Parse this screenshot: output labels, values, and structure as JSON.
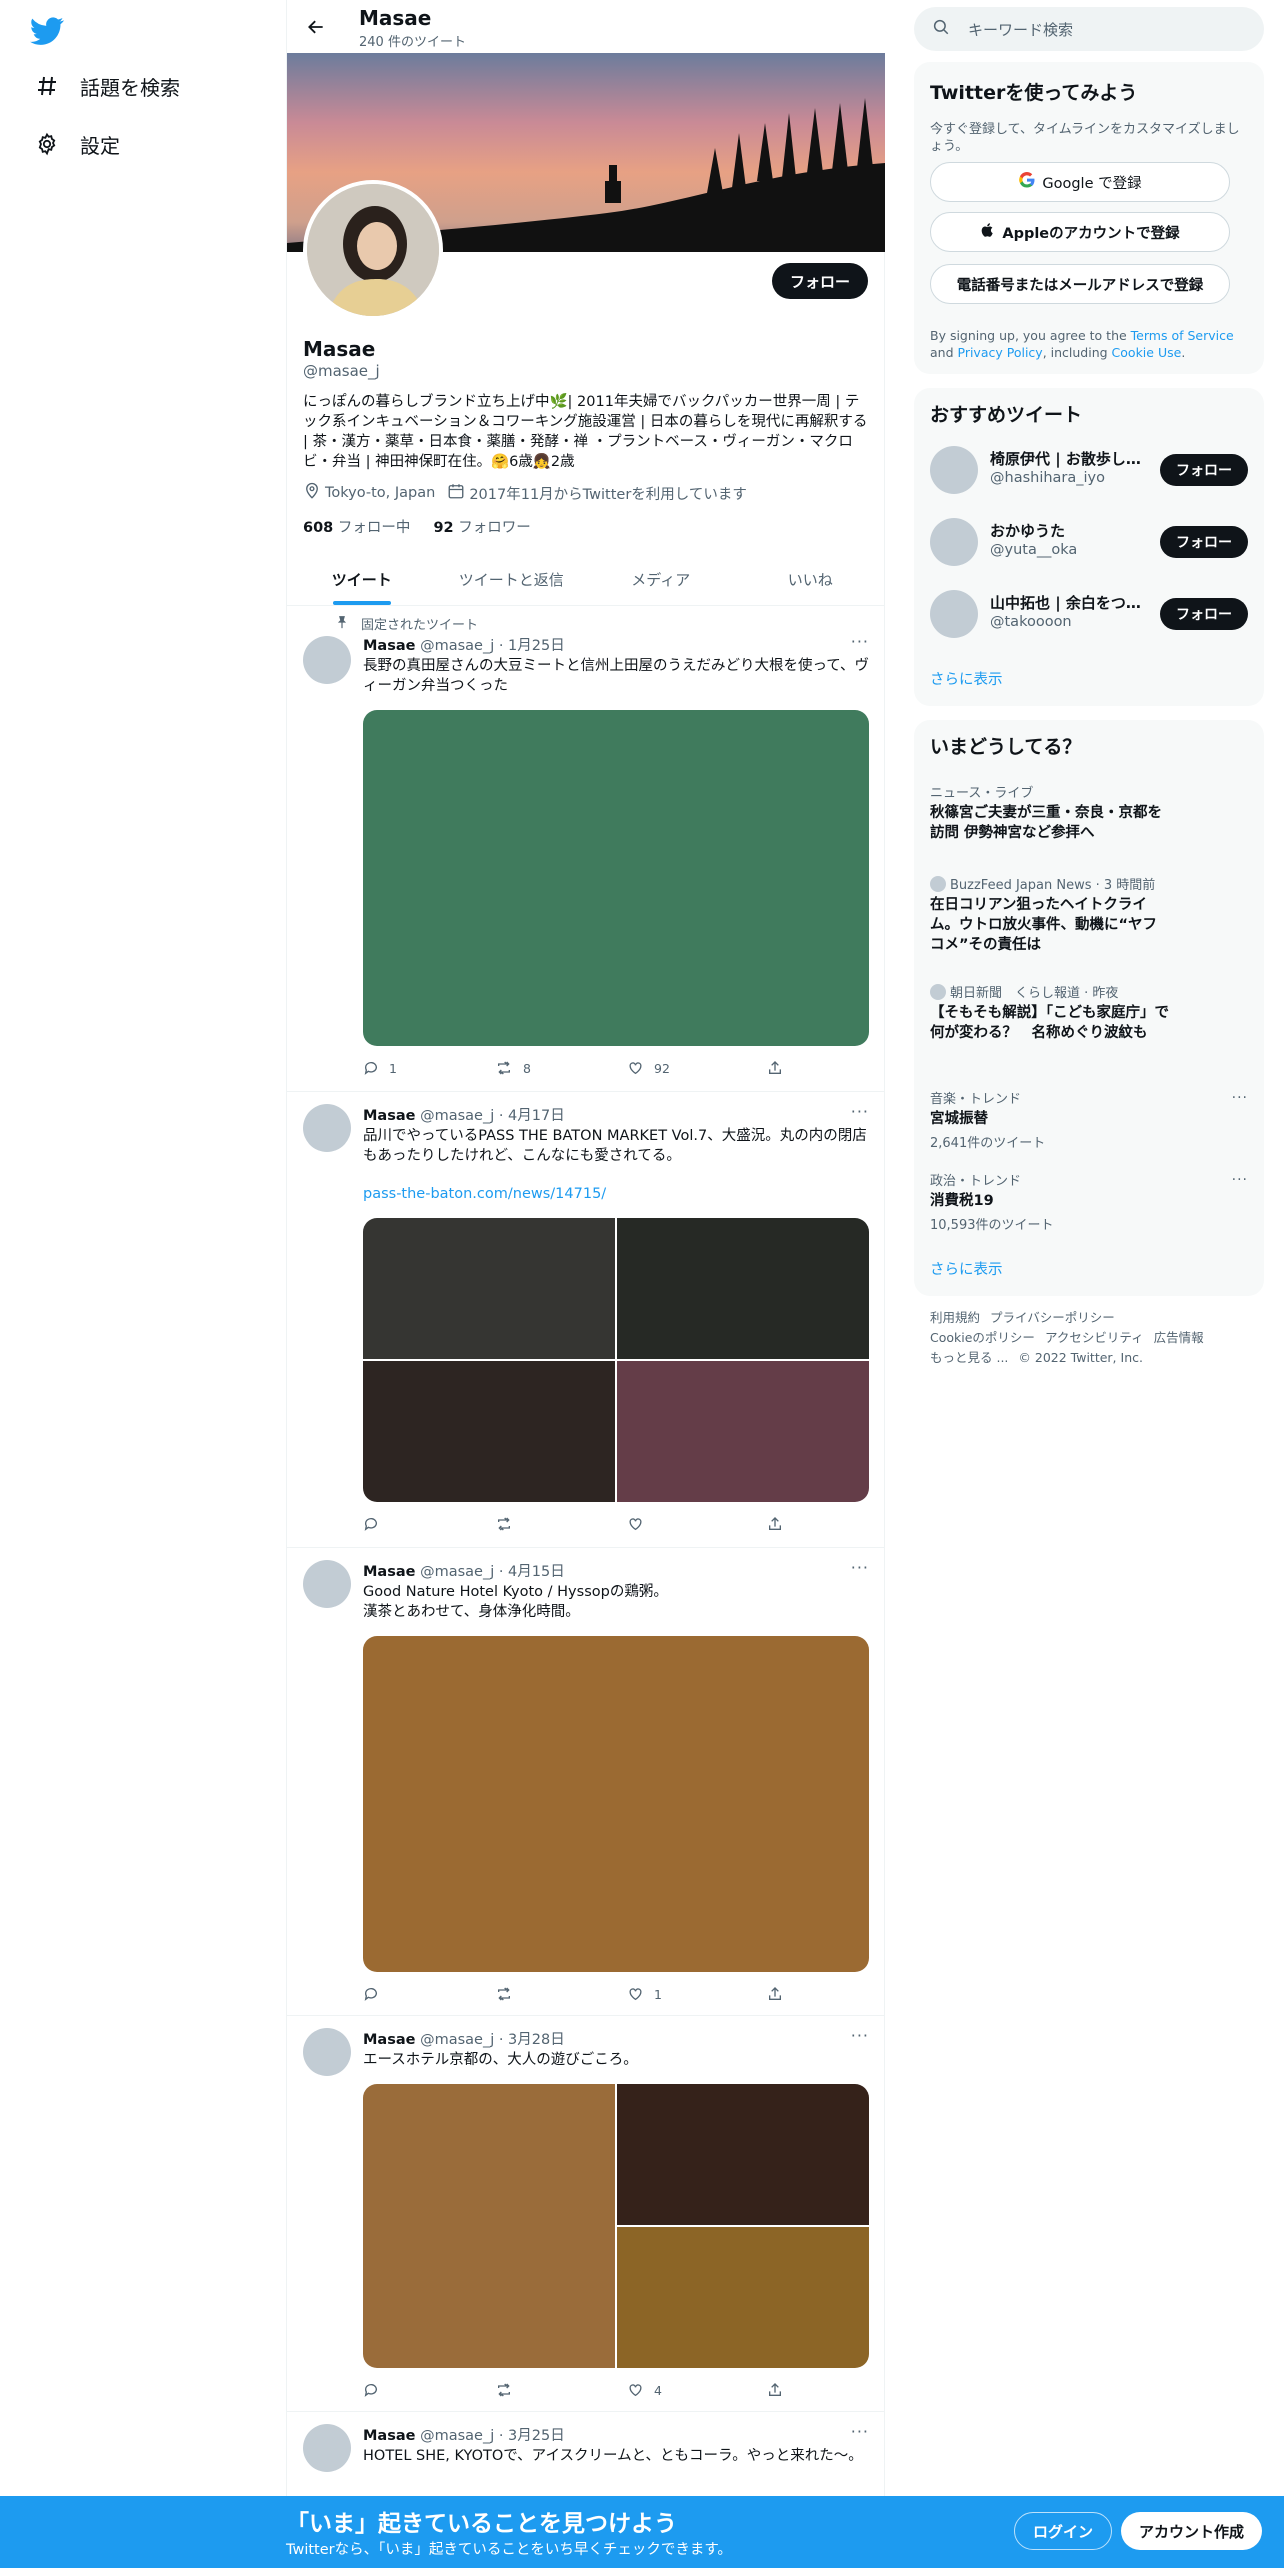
{
  "leftnav": {
    "items": [
      {
        "label": "話題を検索",
        "icon": "hashtag-icon"
      },
      {
        "label": "設定",
        "icon": "gear-icon"
      }
    ]
  },
  "topbar": {
    "title": "Masae",
    "subtitle": "240 件のツイート"
  },
  "profile": {
    "name": "Masae",
    "handle": "@masae_j",
    "follow_label": "フォロー",
    "bio": "にっぽんの暮らしブランド立ち上げ中🌿| 2011年夫婦でバックパッカー世界一周 | テック系インキュベーション＆コワーキング施設運営 | 日本の暮らしを現代に再解釈する | 茶・漢方・薬草・日本食・薬膳・発酵・禅 ・プラントベース・ヴィーガン・マクロビ・弁当 | 神田神保町在住。🤗6歳👧2歳",
    "location": "Tokyo-to, Japan",
    "joined": "2017年11月からTwitterを利用しています",
    "following_count": "608",
    "following_label": "フォロー中",
    "followers_count": "92",
    "followers_label": "フォロワー"
  },
  "tabs": [
    {
      "label": "ツイート",
      "active": true
    },
    {
      "label": "ツイートと返信",
      "active": false
    },
    {
      "label": "メディア",
      "active": false
    },
    {
      "label": "いいね",
      "active": false
    }
  ],
  "tweets": [
    {
      "pinned_label": "固定されたツイート",
      "name": "Masae",
      "meta": "@masae_j · 1月25日",
      "text": "長野の真田屋さんの大豆ミートと信州上田屋のうえだみどり大根を使って、ヴィーガン弁当つくった",
      "media_colors": [
        "#407b5d"
      ],
      "replies": "1",
      "retweets": "8",
      "likes": "92"
    },
    {
      "name": "Masae",
      "meta": "@masae_j · 4月17日",
      "text": "品川でやっているPASS THE BATON MARKET Vol.7、大盛況。丸の内の閉店もあったりしたけれど、こんなにも愛されてる。",
      "link": "pass-the-baton.com/news/14715/",
      "media_colors": [
        "#353532",
        "#262925",
        "#2d2522",
        "#643d48"
      ],
      "replies": "",
      "retweets": "",
      "likes": ""
    },
    {
      "name": "Masae",
      "meta": "@masae_j · 4月15日",
      "text": "Good Nature Hotel Kyoto / Hyssopの鶏粥。\n漢茶とあわせて、身体浄化時間。",
      "media_colors": [
        "#9b6a32"
      ],
      "replies": "",
      "retweets": "",
      "likes": "1"
    },
    {
      "name": "Masae",
      "meta": "@masae_j · 3月28日",
      "text": "エースホテル京都の、大人の遊びごころ。",
      "media_colors": [
        "#9a6c3a",
        "#35221a",
        "#8c6526"
      ],
      "replies": "",
      "retweets": "",
      "likes": "4"
    },
    {
      "name": "Masae",
      "meta": "@masae_j · 3月25日",
      "text": "HOTEL SHE, KYOTOで、アイスクリームと、ともコーラ。やっと来れた〜。"
    }
  ],
  "right": {
    "search_placeholder": "キーワード検索",
    "signup": {
      "title": "Twitterを使ってみよう",
      "subtitle": "今すぐ登録して、タイムラインをカスタマイズしましょう。",
      "google_label": "Google で登録",
      "apple_label": "Appleのアカウントで登録",
      "phone_label": "電話番号またはメールアドレスで登録",
      "legal_prefix": "By signing up, you agree to the ",
      "legal_tos": "Terms of Service",
      "legal_and": " and ",
      "legal_privacy": "Privacy Policy",
      "legal_including": ", including ",
      "legal_cookie": "Cookie Use",
      "legal_end": "."
    },
    "recommend": {
      "title": "おすすめツイート",
      "follow_label": "フォロー",
      "users": [
        {
          "name": "椅原伊代 | お散歩し…",
          "handle": "@hashihara_iyo"
        },
        {
          "name": "おかゆうた",
          "handle": "@yuta__oka"
        },
        {
          "name": "山中拓也 | 余白をつ…",
          "handle": "@takoooon"
        }
      ],
      "more": "さらに表示"
    },
    "trends": {
      "title": "いまどうしてる？",
      "items": [
        {
          "category": "ニュース・ライブ",
          "title": "秋篠宮ご夫妻が三重・奈良・京都を訪問 伊勢神宮など参拝へ"
        },
        {
          "category": "BuzzFeed Japan News · 3 時間前",
          "title": "在日コリアン狙ったヘイトクライム。ウトロ放火事件、動機に“ヤフコメ”その責任は"
        },
        {
          "category": "朝日新聞　くらし報道 · 昨夜",
          "title": "【そもそも解説】「こども家庭庁」で何が変わる？　名称めぐり波紋も"
        },
        {
          "category": "音楽・トレンド",
          "title": "宮城振替",
          "count": "2,641件のツイート"
        },
        {
          "category": "政治・トレンド",
          "title": "消費税19",
          "count": "10,593件のツイート"
        }
      ],
      "more": "さらに表示"
    },
    "footer": {
      "terms": "利用規約",
      "privacy": "プライバシーポリシー",
      "cookie": "Cookieのポリシー",
      "accessibility": "アクセシビリティ",
      "ads": "広告情報",
      "more": "もっと見る ...",
      "copyright": "© 2022 Twitter, Inc."
    }
  },
  "bottombar": {
    "title": "「いま」起きていることを見つけよう",
    "subtitle": "Twitterなら、「いま」起きていることをいち早くチェックできます。",
    "login": "ログイン",
    "signup": "アカウント作成"
  },
  "colors": {
    "accent": "#1d9bf0",
    "text": "#0f1419",
    "muted": "#536471"
  }
}
